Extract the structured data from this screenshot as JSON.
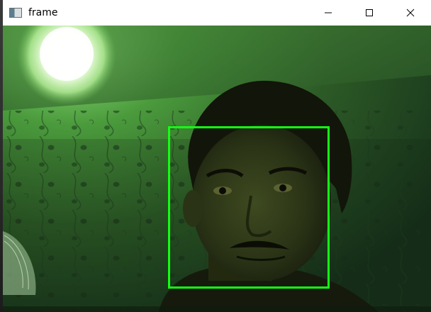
{
  "window": {
    "title": "frame",
    "icon": "opencv-window-icon",
    "controls": {
      "minimize": "minimize-icon",
      "maximize": "maximize-icon",
      "close": "close-icon"
    }
  },
  "frame": {
    "content": "webcam-image",
    "face_box_color": "#14ff14",
    "tint": "green"
  }
}
